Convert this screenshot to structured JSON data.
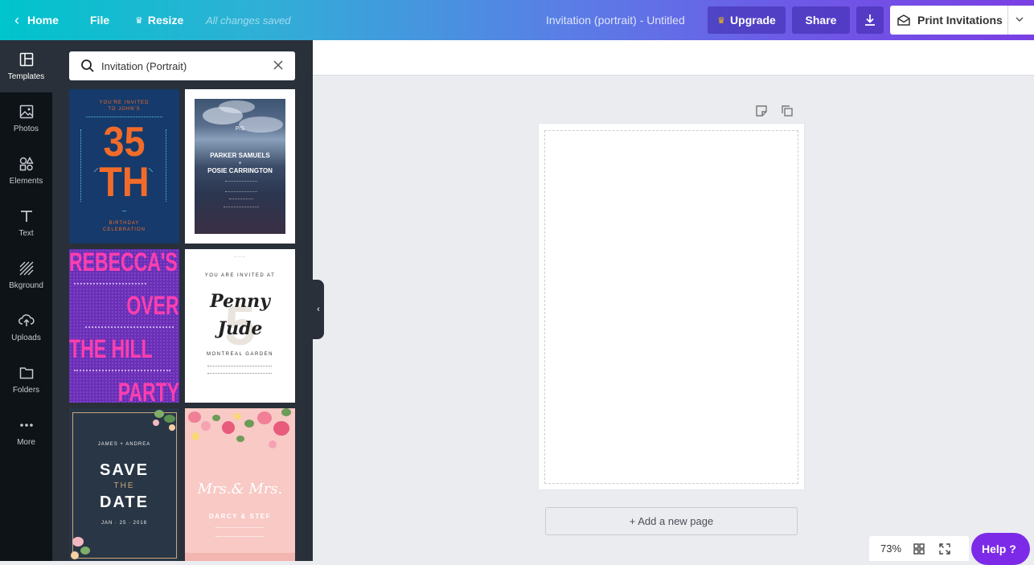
{
  "topbar": {
    "home_label": "Home",
    "file_label": "File",
    "resize_label": "Resize",
    "saved_status": "All changes saved",
    "document_title": "Invitation (portrait) - Untitled",
    "upgrade_label": "Upgrade",
    "share_label": "Share",
    "print_label": "Print Invitations"
  },
  "rail": {
    "items": [
      {
        "label": "Templates",
        "icon": "templates-icon"
      },
      {
        "label": "Photos",
        "icon": "photos-icon"
      },
      {
        "label": "Elements",
        "icon": "elements-icon"
      },
      {
        "label": "Text",
        "icon": "text-icon"
      },
      {
        "label": "Bkground",
        "icon": "background-icon"
      },
      {
        "label": "Uploads",
        "icon": "uploads-icon"
      },
      {
        "label": "Folders",
        "icon": "folders-icon"
      },
      {
        "label": "More",
        "icon": "more-icon"
      }
    ]
  },
  "search": {
    "value": "Invitation (Portrait)"
  },
  "templates": {
    "t1": {
      "line1": "YOU'RE INVITED",
      "line2": "TO JOHN'S",
      "big1": "35",
      "big2": "TH",
      "foot1": "BIRTHDAY",
      "foot2": "CELEBRATION"
    },
    "t2": {
      "mono": "P/S",
      "name1": "PARKER SAMUELS",
      "amp": "+",
      "name2": "POSIE CARRINGTON"
    },
    "t3": {
      "l1": "REBECCA'S",
      "l2": "OVER",
      "l3": "THE HILL",
      "l4": "PARTY"
    },
    "t4": {
      "top": "YOU ARE INVITED AT",
      "name1": "Penny",
      "name2": "Jude",
      "num": "5",
      "foot": "MONTREAL GARDEN"
    },
    "t5": {
      "names": "JAMES + ANDREA",
      "l1": "SAVE",
      "l2": "THE",
      "l3": "DATE",
      "date": "JAN · 25 · 2018"
    },
    "t6": {
      "title": "Mrs.& Mrs.",
      "names": "DARCY & STEF"
    }
  },
  "canvas": {
    "add_page_label": "+ Add a new page",
    "zoom": "73%",
    "help_label": "Help ?"
  },
  "colors": {
    "accent": "#7d2ae8",
    "topbar_start": "#00c4cc",
    "topbar_end": "#7b3fe4",
    "rail_bg": "#0e1318",
    "panel_bg": "#293039"
  }
}
